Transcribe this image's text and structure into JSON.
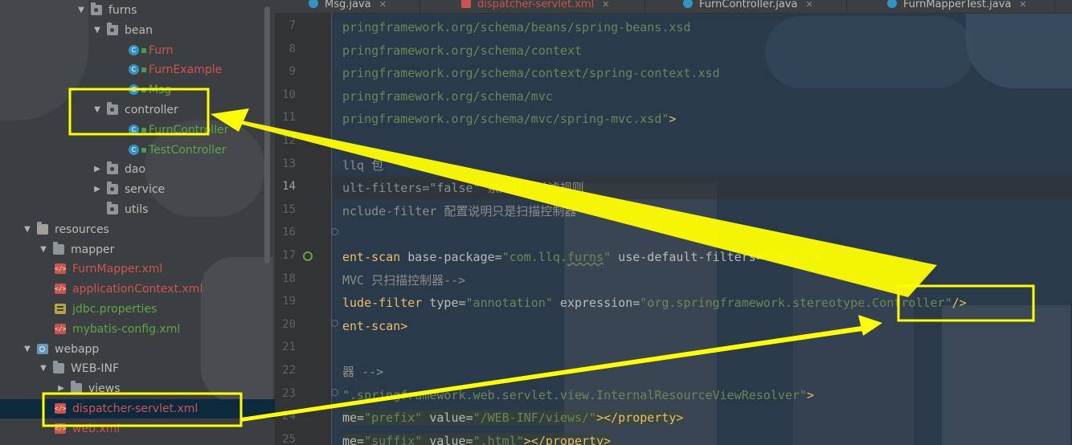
{
  "tree": {
    "rows": [
      {
        "label": "furns",
        "kind": "pkg",
        "arrow": "▼",
        "color": "gray"
      },
      {
        "label": "bean",
        "kind": "pkg",
        "arrow": "▼",
        "color": "gray"
      },
      {
        "label": "Furn",
        "kind": "class",
        "color": "red"
      },
      {
        "label": "FurnExample",
        "kind": "class",
        "color": "red"
      },
      {
        "label": "Msg",
        "kind": "class",
        "color": "green"
      },
      {
        "label": "controller",
        "kind": "pkg",
        "arrow": "▼",
        "color": "gray"
      },
      {
        "label": "FurnController",
        "kind": "class",
        "color": "green"
      },
      {
        "label": "TestController",
        "kind": "class",
        "color": "green"
      },
      {
        "label": "dao",
        "kind": "pkg",
        "arrow": "▶",
        "color": "gray"
      },
      {
        "label": "service",
        "kind": "pkg",
        "arrow": "▶",
        "color": "gray"
      },
      {
        "label": "utils",
        "kind": "pkg",
        "color": "gray"
      },
      {
        "label": "resources",
        "kind": "res",
        "arrow": "▼",
        "color": "gray"
      },
      {
        "label": "mapper",
        "kind": "folder",
        "arrow": "▼",
        "color": "gray"
      },
      {
        "label": "FurnMapper.xml",
        "kind": "xml",
        "color": "red"
      },
      {
        "label": "applicationContext.xml",
        "kind": "xml",
        "color": "red"
      },
      {
        "label": "jdbc.properties",
        "kind": "props",
        "color": "green"
      },
      {
        "label": "mybatis-config.xml",
        "kind": "xml",
        "color": "green"
      },
      {
        "label": "webapp",
        "kind": "web",
        "arrow": "▼",
        "color": "gray"
      },
      {
        "label": "WEB-INF",
        "kind": "folder",
        "arrow": "▼",
        "color": "gray"
      },
      {
        "label": "views",
        "kind": "folder",
        "arrow": "▶",
        "color": "gray"
      },
      {
        "label": "dispatcher-servlet.xml",
        "kind": "xml",
        "color": "red",
        "selected": true
      },
      {
        "label": "web.xml",
        "kind": "xml",
        "color": "red"
      }
    ]
  },
  "tabs": [
    {
      "label": "Msg.java",
      "icon": "class"
    },
    {
      "label": "dispatcher-servlet.xml",
      "icon": "xml",
      "active": true
    },
    {
      "label": "FurnController.java",
      "icon": "class"
    },
    {
      "label": "FurnMapperTest.java",
      "icon": "class"
    }
  ],
  "editor": {
    "current_line": "14",
    "lines": [
      {
        "no": "7",
        "segments": [
          {
            "t": "pringframework.org/schema/beans/spring-beans.xsd",
            "c": "s"
          }
        ]
      },
      {
        "no": "8",
        "segments": [
          {
            "t": "pringframework.org/schema/context",
            "c": "s"
          }
        ]
      },
      {
        "no": "9",
        "segments": [
          {
            "t": "pringframework.org/schema/context/spring-context.xsd",
            "c": "s"
          }
        ]
      },
      {
        "no": "10",
        "segments": [
          {
            "t": "pringframework.org/schema/mvc",
            "c": "s"
          }
        ]
      },
      {
        "no": "11",
        "segments": [
          {
            "t": "pringframework.org/schema/mvc/spring-mvc.xsd\"",
            "c": "s"
          },
          {
            "t": ">",
            "c": "t"
          }
        ]
      },
      {
        "no": "12",
        "segments": []
      },
      {
        "no": "13",
        "segments": [
          {
            "t": "llq 包",
            "c": "cm"
          }
        ]
      },
      {
        "no": "14",
        "segments": [
          {
            "t": "ult-filters=\"false\" 禁用默认过滤规则",
            "c": "cm"
          }
        ]
      },
      {
        "no": "15",
        "segments": [
          {
            "t": "nclude-filter 配置说明只是扫描控制器",
            "c": "cm"
          }
        ]
      },
      {
        "no": "16",
        "segments": []
      },
      {
        "no": "17",
        "segments": [
          {
            "t": "ent-scan",
            "c": "t"
          },
          {
            "t": " base-package=",
            "c": "a"
          },
          {
            "t": "\"com.llq.",
            "c": "s"
          },
          {
            "t": "furns",
            "c": "s",
            "w": true
          },
          {
            "t": "\"",
            "c": "s"
          },
          {
            "t": " use-default-filters=",
            "c": "a"
          },
          {
            "t": "\"false\"",
            "c": "s"
          },
          {
            "t": ">",
            "c": "t"
          }
        ]
      },
      {
        "no": "18",
        "segments": [
          {
            "t": "MVC 只扫描控制器-->",
            "c": "cm"
          }
        ]
      },
      {
        "no": "19",
        "segments": [
          {
            "t": "lude-filter",
            "c": "t"
          },
          {
            "t": " type=",
            "c": "a"
          },
          {
            "t": "\"annotation\"",
            "c": "s"
          },
          {
            "t": " expression=",
            "c": "a"
          },
          {
            "t": "\"org.springframework.stereotype.Controller\"",
            "c": "s"
          },
          {
            "t": "/>",
            "c": "t"
          }
        ]
      },
      {
        "no": "20",
        "segments": [
          {
            "t": "ent-scan>",
            "c": "t"
          }
        ]
      },
      {
        "no": "21",
        "segments": []
      },
      {
        "no": "22",
        "segments": [
          {
            "t": "器 -->",
            "c": "cm"
          }
        ]
      },
      {
        "no": "23",
        "segments": [
          {
            "t": "\"",
            "c": "s"
          },
          {
            "t": ".springframework.web.servlet.view.InternalResourceViewResolver\"",
            "c": "s"
          },
          {
            "t": ">",
            "c": "t"
          }
        ]
      },
      {
        "no": "24",
        "segments": [
          {
            "t": "me=",
            "c": "a"
          },
          {
            "t": "\"prefix\"",
            "c": "s"
          },
          {
            "t": " value=",
            "c": "a"
          },
          {
            "t": "\"/WEB-INF/views/\"",
            "c": "s"
          },
          {
            "t": "></property>",
            "c": "t"
          }
        ]
      },
      {
        "no": "25",
        "segments": [
          {
            "t": "me=",
            "c": "a"
          },
          {
            "t": "\"suffix\"",
            "c": "s"
          },
          {
            "t": " value=",
            "c": "a"
          },
          {
            "t": "\".html\"",
            "c": "s"
          },
          {
            "t": "></property>",
            "c": "t"
          }
        ]
      }
    ]
  },
  "colors": {
    "annotation": "#ffff00",
    "tree_red": "#d25252",
    "tree_green": "#62a34a",
    "selection": "#0d293e"
  }
}
